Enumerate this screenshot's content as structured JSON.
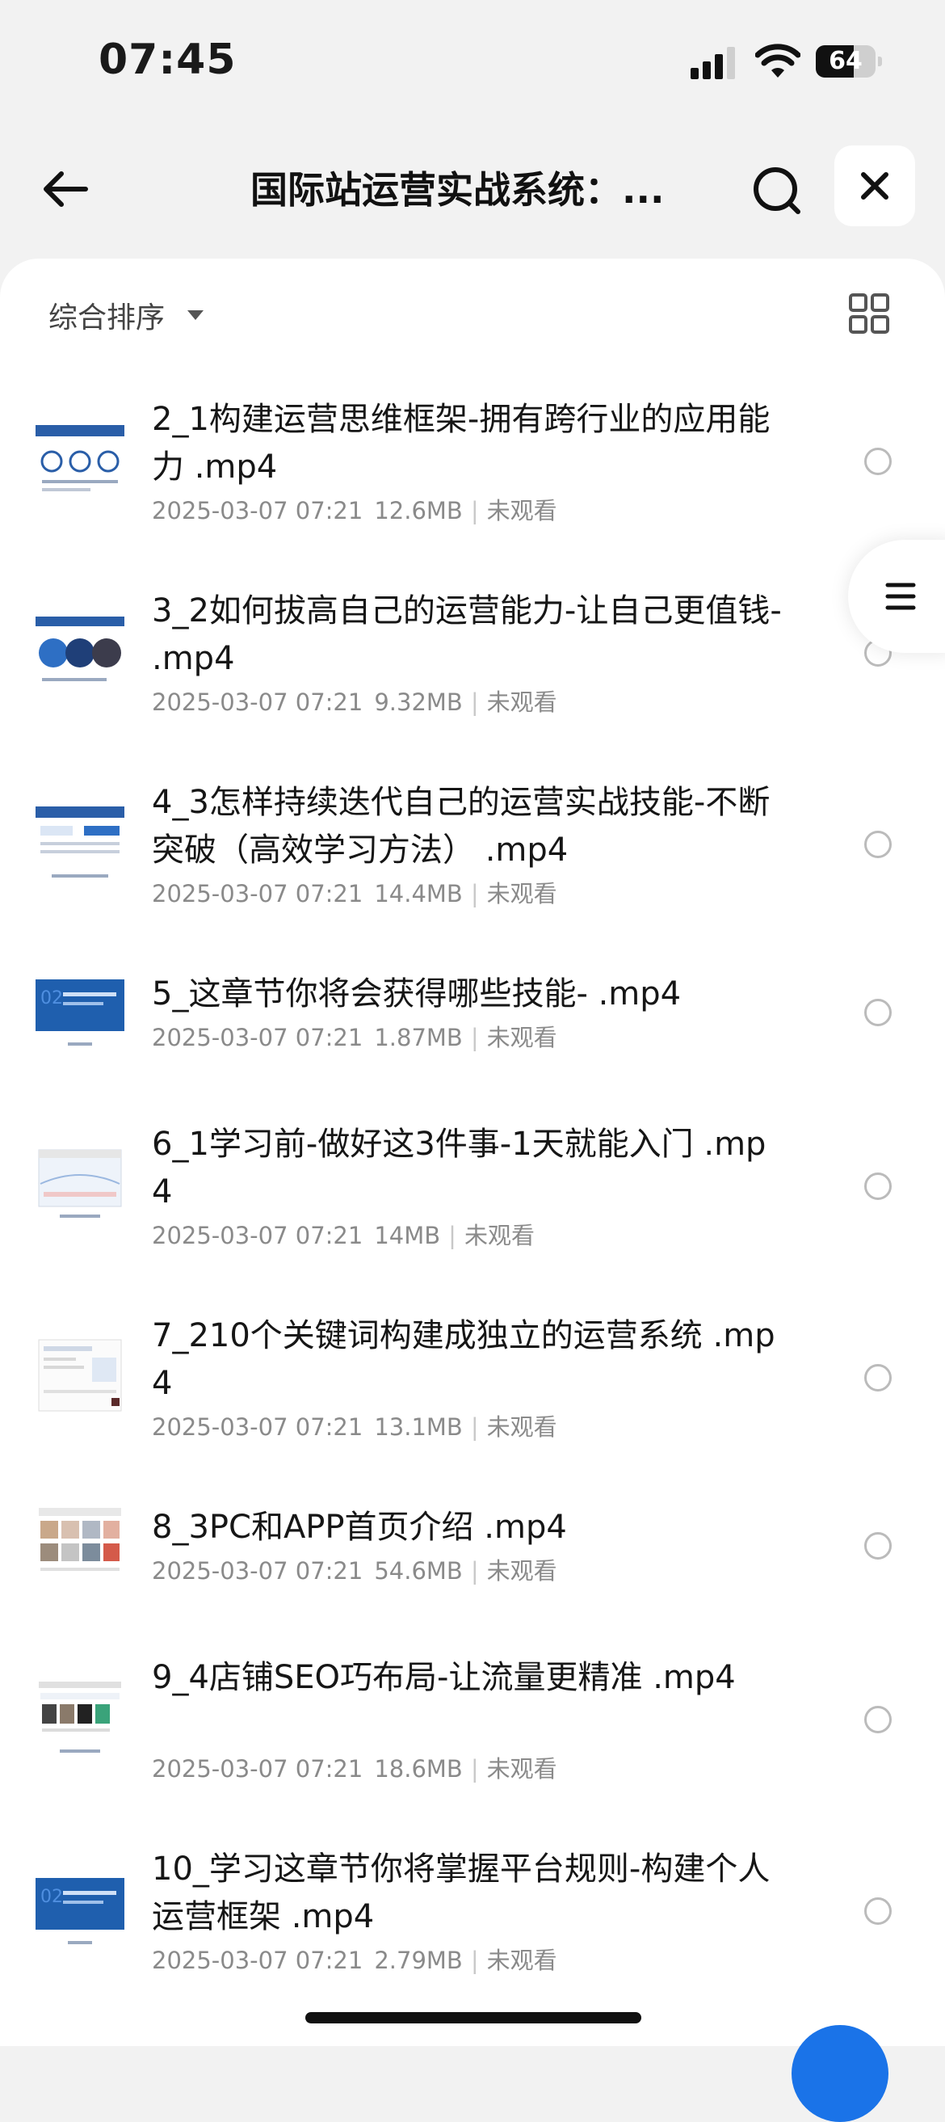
{
  "status_bar": {
    "time": "07:45",
    "battery_percent": "64",
    "battery_level": 0.64
  },
  "nav": {
    "title": "国际站运营实战系统：..."
  },
  "toolbar": {
    "sort_label": "综合排序"
  },
  "files": [
    {
      "name": "2_1构建运营思维框架-拥有跨行业的应用能力  .mp4",
      "date": "2025-03-07 07:21",
      "size": "12.6MB",
      "status": "未观看",
      "thumb": "blue-diagram"
    },
    {
      "name": "3_2如何拔高自己的运营能力-让自己更值钱-  .mp4",
      "date": "2025-03-07 07:21",
      "size": "9.32MB",
      "status": "未观看",
      "thumb": "circles"
    },
    {
      "name": "4_3怎样持续迭代自己的运营实战技能-不断突破（高效学习方法） .mp4",
      "date": "2025-03-07 07:21",
      "size": "14.4MB",
      "status": "未观看",
      "thumb": "flow"
    },
    {
      "name": "5_这章节你将会获得哪些技能-  .mp4",
      "date": "2025-03-07 07:21",
      "size": "1.87MB",
      "status": "未观看",
      "thumb": "blue-slide"
    },
    {
      "name": "6_1学习前-做好这3件事-1天就能入门 .mp4",
      "date": "2025-03-07 07:21",
      "size": "14MB",
      "status": "未观看",
      "thumb": "screen"
    },
    {
      "name": "7_210个关键词构建成独立的运营系统 .mp4",
      "date": "2025-03-07 07:21",
      "size": "13.1MB",
      "status": "未观看",
      "thumb": "screen2"
    },
    {
      "name": "8_3PC和APP首页介绍  .mp4",
      "date": "2025-03-07 07:21",
      "size": "54.6MB",
      "status": "未观看",
      "thumb": "products"
    },
    {
      "name": "9_4店铺SEO巧布局-让流量更精准  .mp4",
      "date": "2025-03-07 07:21",
      "size": "18.6MB",
      "status": "未观看",
      "thumb": "shop"
    },
    {
      "name": "10_学习这章节你将掌握平台规则-构建个人运营框架  .mp4",
      "date": "2025-03-07 07:21",
      "size": "2.79MB",
      "status": "未观看",
      "thumb": "blue-slide"
    }
  ]
}
